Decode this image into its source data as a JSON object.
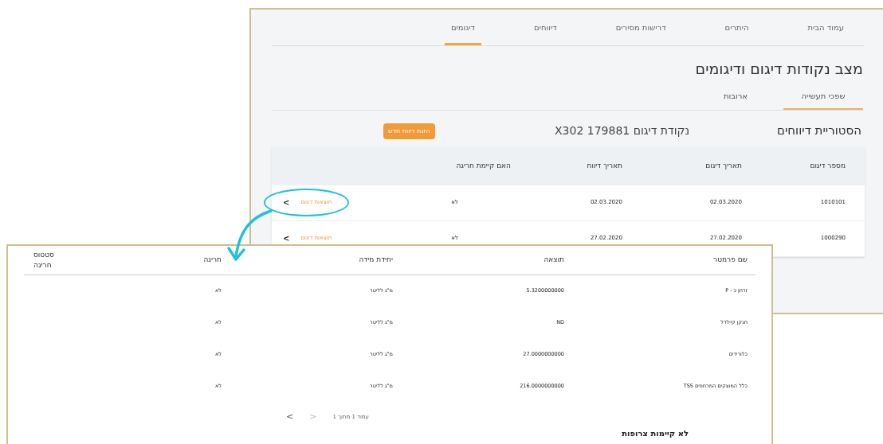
{
  "back_window": {
    "nav": [
      {
        "label": "עמוד הבית",
        "selected": false
      },
      {
        "label": "היתרים",
        "selected": false
      },
      {
        "label": "דרישות מסירים",
        "selected": false
      },
      {
        "label": "דיווחים",
        "selected": false
      },
      {
        "label": "דיגומים",
        "selected": true
      }
    ],
    "title": "מצב נקודות דיגום ודיגומים",
    "sub_tabs": [
      {
        "label": "שפכי תעשייה",
        "selected": true
      },
      {
        "label": "ארובות",
        "selected": false
      }
    ],
    "section_title": "הסטוריית דיווחים",
    "sampling_point": "נקודת דיגום 179881 X302",
    "action_button": "הזנת דיווח חדש",
    "table": {
      "columns": [
        "מספר דיגום",
        "תאריך דיגום",
        "תאריך דיווח",
        "האם קיימת חריגה"
      ],
      "rows": [
        {
          "cells": [
            "1010101",
            "02.03.2020",
            "02.03.2020",
            "לא"
          ],
          "link": "תוצאות דיגום",
          "chevron": "<",
          "highlighted": true
        },
        {
          "cells": [
            "1000290",
            "27.02.2020",
            "27.02.2020",
            "לא"
          ],
          "link": "תוצאות דיגום",
          "chevron": "<",
          "highlighted": false
        }
      ]
    }
  },
  "front_window": {
    "table": {
      "columns": [
        "שם פרמטר",
        "תוצאה",
        "יחידת מידה",
        "חריגה",
        "סטטוס חריגה"
      ],
      "rows": [
        [
          "זרחן כ - P",
          "5.3200000000",
          "מ\"ג לליטר",
          "לא"
        ],
        [
          "חנקן קיילדל",
          "ND",
          "מ\"ג לליטר",
          "לא"
        ],
        [
          "כלורידים",
          "27.0000000000",
          "מ\"ג לליטר",
          "לא"
        ],
        [
          "כלל המוצקים המרחפים TSS",
          "216.0000000000",
          "מ\"ג לליטר",
          "לא"
        ]
      ]
    },
    "pagination": {
      "prev": "<",
      "next": ">",
      "label": "עמוד 1 מתוך 1"
    },
    "attachments": "לא קיימות צרופות"
  }
}
